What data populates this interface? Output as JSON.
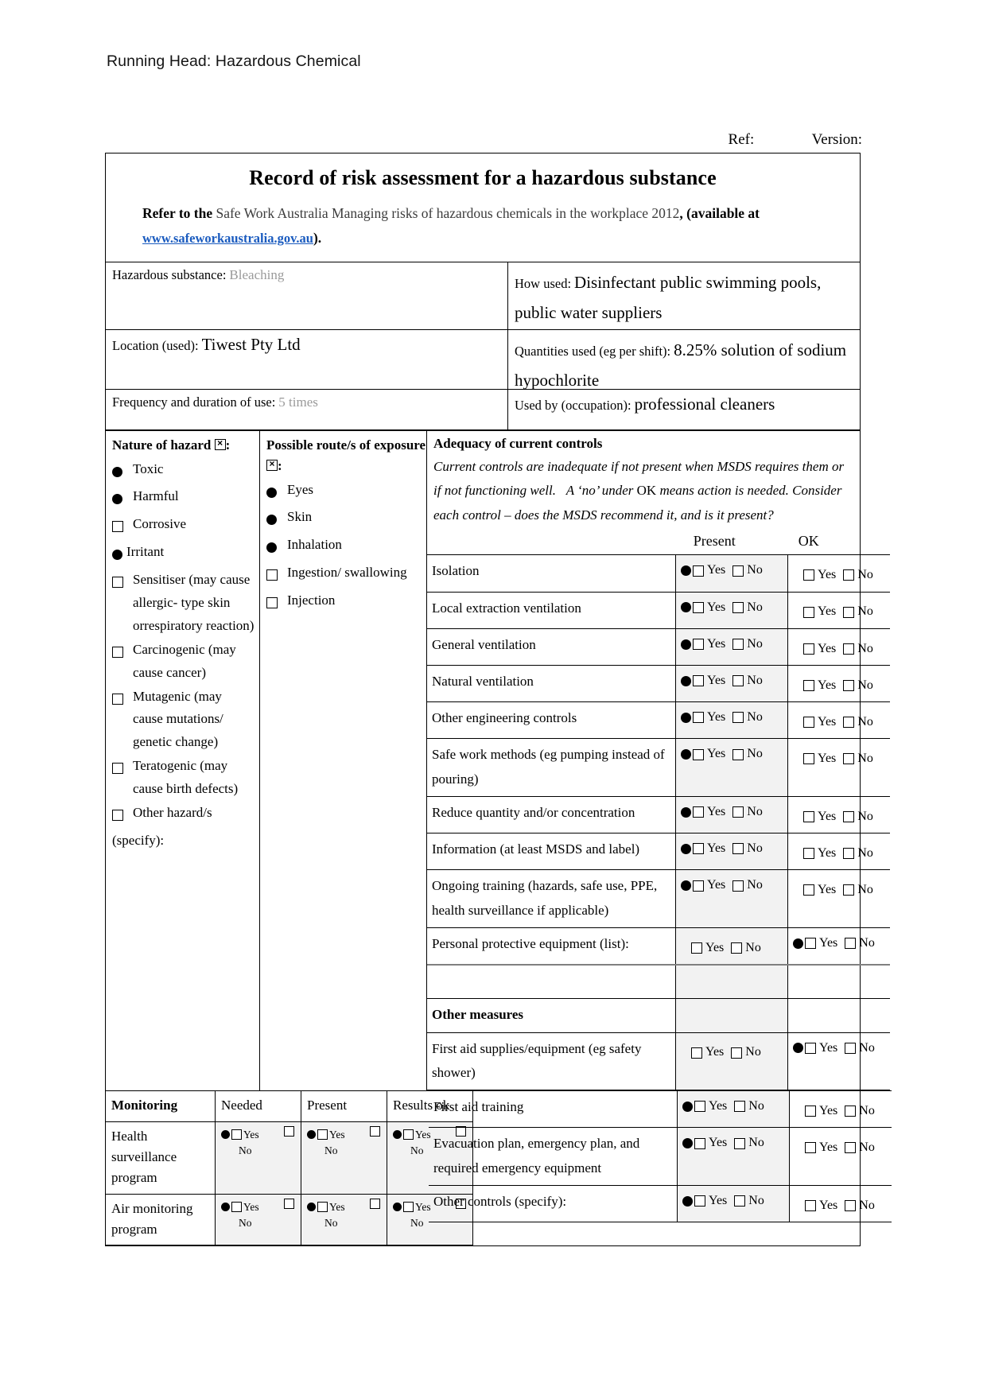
{
  "running_head": "Running Head: Hazardous Chemical",
  "header_meta": {
    "ref_label": "Ref:",
    "version_label": "Version:"
  },
  "form": {
    "title": "Record of risk assessment for a hazardous substance",
    "refer_bold": "Refer to the",
    "refer_grey": "Safe Work Australia Managing risks of hazardous chemicals in the workplace 2012",
    "refer_available": ", (available at",
    "url": "www.safeworkaustralia.gov.au",
    "refer_close": ")."
  },
  "info": {
    "substance_label": "Hazardous substance:",
    "substance_value": "Bleaching",
    "how_used_label": "How used:",
    "how_used_value": "Disinfectant public swimming pools, public water suppliers",
    "location_label": "Location (used):",
    "location_value": "Tiwest Pty Ltd",
    "quantities_label": "Quantities used (eg per shift):",
    "quantities_value": "8.25% solution of sodium hypochlorite",
    "frequency_label": "Frequency and duration of use:",
    "frequency_value": "5 times",
    "used_by_label": "Used by (occupation):",
    "used_by_value": "professional cleaners"
  },
  "hazard": {
    "heading": "Nature of hazard",
    "heading_suffix": ":",
    "items": [
      {
        "label": "Toxic",
        "mark": "dot"
      },
      {
        "label": "Harmful",
        "mark": "dot"
      },
      {
        "label": "Corrosive",
        "mark": "checkbox"
      },
      {
        "label": "Irritant",
        "mark": "dot-tight"
      },
      {
        "label": "Sensitiser (may cause allergic- type skin orrespiratory reaction)",
        "mark": "checkbox"
      },
      {
        "label": "Carcinogenic (may cause cancer)",
        "mark": "checkbox"
      },
      {
        "label": "Mutagenic (may cause mutations/ genetic change)",
        "mark": "checkbox"
      },
      {
        "label": "Teratogenic (may cause birth defects)",
        "mark": "checkbox"
      },
      {
        "label": "Other hazard/s",
        "mark": "checkbox"
      }
    ],
    "specify": "(specify):"
  },
  "route": {
    "heading": "Possible route/s of exposure",
    "heading_suffix": ":",
    "items": [
      {
        "label": "Eyes",
        "mark": "dot"
      },
      {
        "label": "Skin",
        "mark": "dot"
      },
      {
        "label": "Inhalation",
        "mark": "dot"
      },
      {
        "label": "Ingestion/ swallowing",
        "mark": "checkbox"
      },
      {
        "label": "Injection",
        "mark": "checkbox"
      }
    ]
  },
  "controls": {
    "title": "Adequacy of current controls",
    "note_1": "Current controls are inadequate if not present when MSDS requires them or if not functioning well.",
    "note_2": "A ‘no’ under",
    "note_2b": "OK",
    "note_2c": "means action is needed. Consider each control – does the MSDS recommend it, and is it present?",
    "col_present": "Present",
    "col_ok": "OK",
    "yes_label": "Yes",
    "no_label": "No",
    "other_measures_label": "Other measures",
    "rows": [
      {
        "name": "Isolation",
        "present_dot": true,
        "ok_dot": false
      },
      {
        "name": "Local extraction ventilation",
        "present_dot": true,
        "ok_dot": false
      },
      {
        "name": "General ventilation",
        "present_dot": true,
        "ok_dot": false
      },
      {
        "name": "Natural ventilation",
        "present_dot": true,
        "ok_dot": false
      },
      {
        "name": "Other engineering controls",
        "present_dot": true,
        "ok_dot": false
      },
      {
        "name": "Safe work methods (eg pumping instead of pouring)",
        "present_dot": true,
        "ok_dot": false
      },
      {
        "name": "Reduce quantity and/or concentration",
        "present_dot": true,
        "ok_dot": false
      },
      {
        "name": "Information (at least MSDS and label)",
        "present_dot": true,
        "ok_dot": false
      },
      {
        "name": "Ongoing training (hazards, safe use, PPE, health surveillance if applicable)",
        "present_dot": true,
        "ok_dot": false
      },
      {
        "name": "Personal protective equipment (list):",
        "present_dot": false,
        "ok_dot": true
      }
    ],
    "rows_other": [
      {
        "name": "First aid supplies/equipment (eg safety shower)",
        "present_dot": false,
        "ok_dot": true
      },
      {
        "name": "First aid training",
        "present_dot": true,
        "ok_dot": false
      },
      {
        "name": "Evacuation plan, emergency plan, and required emergency equipment",
        "present_dot": true,
        "ok_dot": false
      },
      {
        "name": "Other controls (specify):",
        "present_dot": true,
        "ok_dot": false
      }
    ]
  },
  "monitoring": {
    "headers": [
      "Monitoring",
      "Needed",
      "Present",
      "Results ok"
    ],
    "yes_label": "Yes",
    "no_label": "No",
    "rows": [
      {
        "name": "Health surveillance program",
        "cells": [
          "needed",
          "present",
          "results"
        ]
      },
      {
        "name": "Air monitoring program",
        "cells": [
          "needed",
          "present",
          "results"
        ]
      }
    ]
  }
}
